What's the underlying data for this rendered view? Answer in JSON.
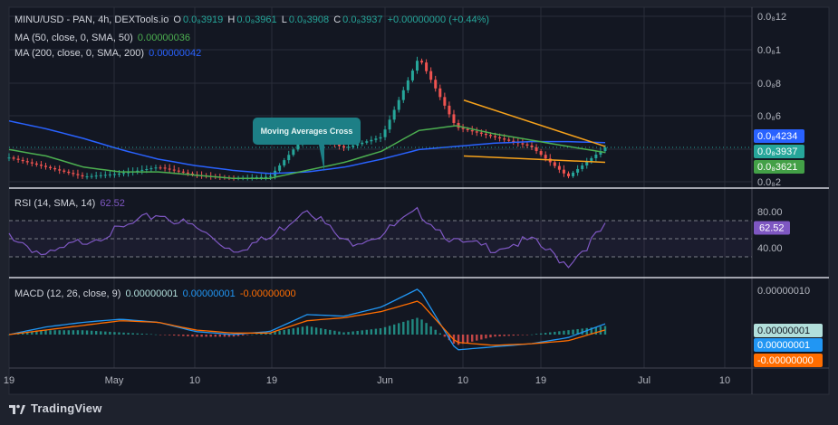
{
  "header": {
    "symbol": "MINU/USD - PAN, 4h, DEXTools.io",
    "o_label": "O",
    "o_value": "0.0₈3919",
    "h_label": "H",
    "h_value": "0.0₈3961",
    "l_label": "L",
    "l_value": "0.0₈3908",
    "c_label": "C",
    "c_value": "0.0₈3937",
    "change": "+0.00000000 (+0.44%)",
    "ma50_label": "MA (50, close, 0, SMA, 50)",
    "ma50_value": "0.00000036",
    "ma200_label": "MA (200, close, 0, SMA, 200)",
    "ma200_value": "0.00000042"
  },
  "rsi": {
    "label": "RSI (14, SMA, 14)",
    "value": "62.52"
  },
  "macd": {
    "label": "MACD (12, 26, close, 9)",
    "v1": "0.00000001",
    "v2": "0.00000001",
    "v3": "-0.00000000"
  },
  "annotation": "Moving Averages Cross",
  "price_axis": [
    "0.0₈12",
    "0.0₈1",
    "0.0₈8",
    "0.0₈6",
    "0.0₈4",
    "0.0₈2"
  ],
  "price_badges": [
    {
      "text": "0.0₈4234",
      "color": "#2962ff"
    },
    {
      "text": "0.0₈3937",
      "color": "#26a69a"
    },
    {
      "text": "0.0₈3621",
      "color": "#43a047"
    }
  ],
  "rsi_axis": [
    "80.00",
    "40.00"
  ],
  "rsi_badge": "62.52",
  "macd_axis": [
    "0.00000010"
  ],
  "macd_badges": [
    {
      "text": "0.00000001",
      "color": "#b2dfdb",
      "fg": "#131722"
    },
    {
      "text": "0.00000001",
      "color": "#2196f3",
      "fg": "#ffffff"
    },
    {
      "text": "-0.00000000",
      "color": "#ff6d00",
      "fg": "#ffffff"
    }
  ],
  "time_axis": [
    "19",
    "May",
    "10",
    "19",
    "Jun",
    "10",
    "19",
    "Jul",
    "10"
  ],
  "brand": "TradingView",
  "colors": {
    "up": "#26a69a",
    "down": "#ef5350",
    "ma50": "#4caf50",
    "ma200": "#2962ff",
    "trend": "#f7a21b",
    "rsi": "#7e57c2",
    "macd": "#2196f3",
    "signal": "#ff6d00"
  },
  "chart_data": {
    "type": "line",
    "price_series": {
      "name": "MINU/USD",
      "x": [
        "Apr 19",
        "Apr 24",
        "Apr 29",
        "May 4",
        "May 10",
        "May 15",
        "May 19",
        "May 24",
        "May 29",
        "Jun 1",
        "Jun 5",
        "Jun 10",
        "Jun 14",
        "Jun 19",
        "Jun 23",
        "Jun 26",
        "Jun 27"
      ],
      "y": [
        3.3,
        2.7,
        2.1,
        2.3,
        2.7,
        2.2,
        2.0,
        2.1,
        4.8,
        3.9,
        4.6,
        9.6,
        5.2,
        4.6,
        4.0,
        2.1,
        3.937
      ]
    },
    "ma50": {
      "name": "MA (50, close, 0, SMA, 50)",
      "y": [
        3.8,
        3.4,
        2.7,
        2.4,
        2.4,
        2.2,
        2.0,
        2.0,
        2.5,
        3.0,
        3.7,
        5.0,
        5.3,
        4.8,
        4.4,
        4.0,
        3.621
      ]
    },
    "ma200": {
      "name": "MA (200, close, 0, SMA, 200)",
      "y": [
        5.6,
        5.1,
        4.5,
        3.8,
        3.2,
        2.8,
        2.5,
        2.3,
        2.4,
        2.7,
        3.2,
        3.8,
        4.0,
        4.2,
        4.3,
        4.3,
        4.234
      ]
    },
    "rsi_series": {
      "name": "RSI (14, SMA, 14)",
      "y": [
        55,
        30,
        48,
        60,
        78,
        62,
        38,
        50,
        86,
        45,
        55,
        80,
        45,
        40,
        48,
        22,
        62.52
      ]
    },
    "macd_line": {
      "y": [
        0.0,
        0.5,
        0.8,
        1.0,
        0.8,
        0.2,
        0.0,
        0.2,
        1.3,
        1.2,
        1.8,
        3.0,
        -1.0,
        -0.8,
        -0.6,
        -0.2,
        0.7
      ]
    },
    "signal_line": {
      "y": [
        0.0,
        0.3,
        0.6,
        0.9,
        0.8,
        0.3,
        0.1,
        0.1,
        0.9,
        1.1,
        1.5,
        2.2,
        -0.5,
        -0.7,
        -0.6,
        -0.4,
        0.3
      ]
    },
    "ylim_price": [
      1.5,
      12.5
    ],
    "ylim_rsi": [
      10,
      100
    ],
    "grid": true
  }
}
